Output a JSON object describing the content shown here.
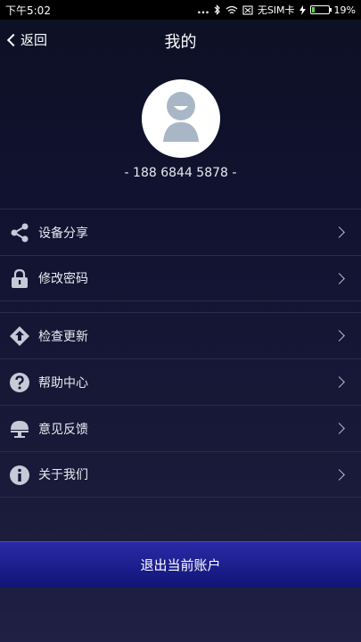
{
  "status": {
    "time": "下午5:02",
    "dots": "...",
    "sim": "无SIM卡",
    "battery": "19%",
    "battery_level": 0.19,
    "battery_color": "#5bd64b"
  },
  "nav": {
    "back_label": "返回",
    "title": "我的"
  },
  "profile": {
    "phone": "- 188 6844 5878 -"
  },
  "menu_groups": [
    [
      {
        "label": "设备分享",
        "icon": "share-icon"
      },
      {
        "label": "修改密码",
        "icon": "lock-icon"
      }
    ],
    [
      {
        "label": "检查更新",
        "icon": "update-icon"
      },
      {
        "label": "帮助中心",
        "icon": "help-icon"
      },
      {
        "label": "意见反馈",
        "icon": "feedback-icon"
      },
      {
        "label": "关于我们",
        "icon": "info-icon"
      }
    ]
  ],
  "logout_label": "退出当前账户",
  "colors": {
    "accent": "#2a2aa8",
    "icon": "#c6c9d6"
  }
}
